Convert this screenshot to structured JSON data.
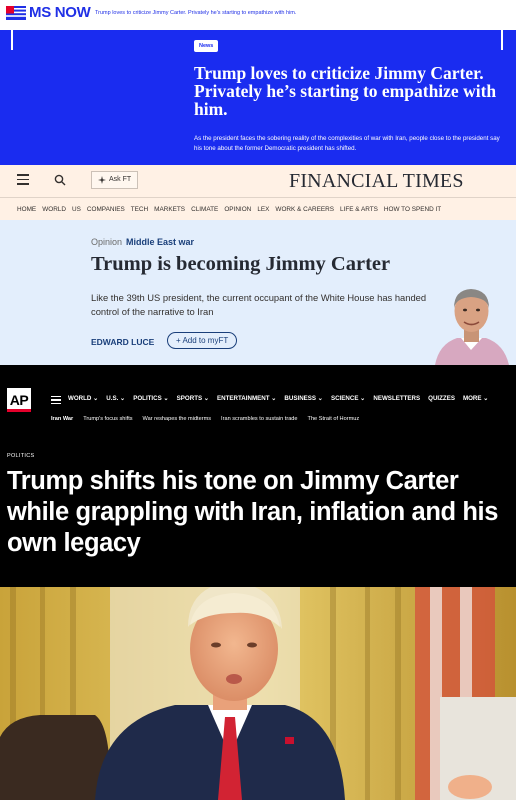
{
  "ms_now": {
    "logo": "MS NOW",
    "ticker": "Trump loves to criticize Jimmy Carter. Privately he's starting to empathize with him.",
    "badge": "News",
    "headline": "Trump loves to criticize Jimmy Carter. Privately he’s starting to empathize with him.",
    "dek": "As the president faces the sobering reality of the complexities of war with Iran, people close to the president say his tone about the former Democratic president has shifted.",
    "colors": {
      "brand": "#1a2cf0",
      "text": "#ffffff"
    }
  },
  "ft": {
    "ask_label": "Ask FT",
    "title": "FINANCIAL TIMES",
    "nav": [
      "HOME",
      "WORLD",
      "US",
      "COMPANIES",
      "TECH",
      "MARKETS",
      "CLIMATE",
      "OPINION",
      "LEX",
      "WORK & CAREERS",
      "LIFE & ARTS",
      "HOW TO SPEND IT"
    ],
    "kicker_opinion": "Opinion",
    "kicker_topic": "Middle East war",
    "headline": "Trump is becoming Jimmy Carter",
    "standfirst": "Like the 39th US president, the current occupant of the White House has handed control of the narrative to Iran",
    "author": "EDWARD LUCE",
    "follow_label": "+ Add to myFT",
    "icons": {
      "menu": "hamburger-icon",
      "search": "search-icon",
      "ask": "sparkle-icon"
    },
    "colors": {
      "paper": "#fff1e5",
      "opinion_bg": "#e3eefc",
      "link": "#1a3f7a"
    }
  },
  "ap": {
    "logo": "AP",
    "nav": [
      "WORLD ⌄",
      "U.S. ⌄",
      "POLITICS ⌄",
      "SPORTS ⌄",
      "ENTERTAINMENT ⌄",
      "BUSINESS ⌄",
      "SCIENCE ⌄",
      "NEWSLETTERS",
      "QUIZZES",
      "MORE ⌄"
    ],
    "sub_nav": [
      "Iran War",
      "Trump's focus shifts",
      "War reshapes the midterms",
      "Iran scrambles to sustain trade",
      "The Strait of Hormuz"
    ],
    "section": "POLITICS",
    "headline": "Trump shifts his tone on Jimmy Carter while grappling with Iran, inflation and his own legacy",
    "colors": {
      "bg": "#000000",
      "accent": "#e4002b"
    }
  },
  "photo": {
    "icons": {
      "main": "portrait-photo"
    }
  }
}
